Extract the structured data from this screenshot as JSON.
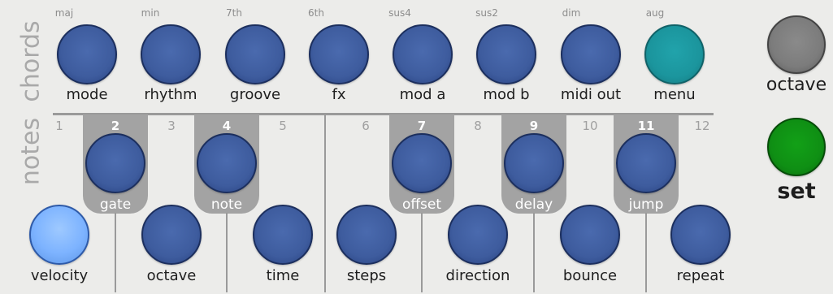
{
  "side_labels": {
    "chords": "chords",
    "notes": "notes"
  },
  "chords": [
    {
      "top": "maj",
      "label": "mode"
    },
    {
      "top": "min",
      "label": "rhythm"
    },
    {
      "top": "7th",
      "label": "groove"
    },
    {
      "top": "6th",
      "label": "fx"
    },
    {
      "top": "sus4",
      "label": "mod a"
    },
    {
      "top": "sus2",
      "label": "mod b"
    },
    {
      "top": "dim",
      "label": "midi out"
    },
    {
      "top": "aug",
      "label": "menu"
    }
  ],
  "note_numbers": [
    "1",
    "2",
    "3",
    "4",
    "5",
    "6",
    "7",
    "8",
    "9",
    "10",
    "11",
    "12"
  ],
  "tabs": [
    "gate",
    "note",
    "offset",
    "delay",
    "jump"
  ],
  "bottom": [
    "velocity",
    "octave",
    "time",
    "steps",
    "direction",
    "bounce",
    "repeat"
  ],
  "right": {
    "octave_label": "octave",
    "set_label": "set"
  },
  "colors": {
    "button_blue": "#3e5c9e",
    "menu_teal": "#1b959d",
    "velocity_light": "#7db3ff",
    "octave_grey": "#7c7c7c",
    "set_green": "#0f8f14",
    "tab_grey": "#a3a3a3"
  }
}
